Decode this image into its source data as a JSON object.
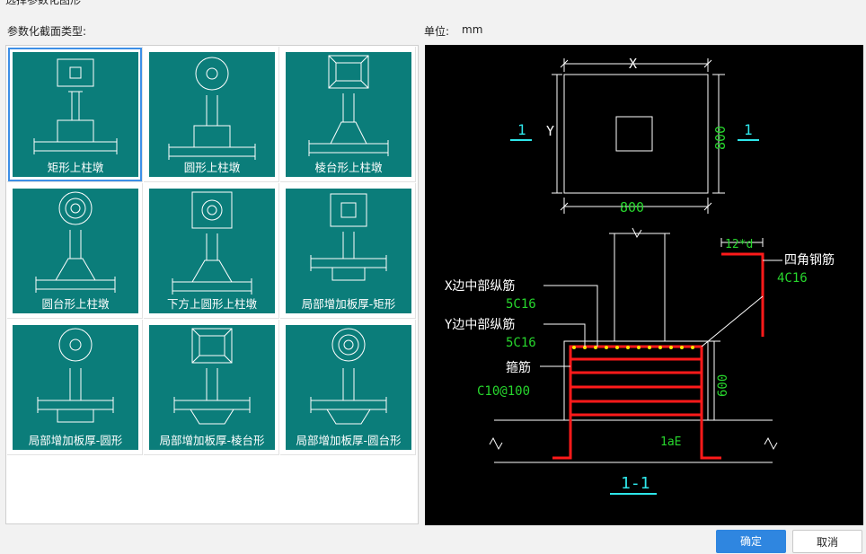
{
  "window": {
    "title": "选择参数化图形"
  },
  "left_label": "参数化截面类型:",
  "unit": {
    "label": "单位:",
    "value": "mm"
  },
  "tiles": [
    {
      "label": "矩形上柱墩",
      "icon": "rect-pier-icon"
    },
    {
      "label": "圆形上柱墩",
      "icon": "round-pier-icon"
    },
    {
      "label": "棱台形上柱墩",
      "icon": "frustum-pier-icon"
    },
    {
      "label": "圆台形上柱墩",
      "icon": "cone-frustum-pier-icon"
    },
    {
      "label": "下方上圆形上柱墩",
      "icon": "square-round-pier-icon"
    },
    {
      "label": "局部增加板厚-矩形",
      "icon": "slab-thicken-rect-icon"
    },
    {
      "label": "局部增加板厚-圆形",
      "icon": "slab-thicken-round-icon"
    },
    {
      "label": "局部增加板厚-棱台形",
      "icon": "slab-thicken-frustum-icon"
    },
    {
      "label": "局部增加板厚-圆台形",
      "icon": "slab-thicken-cone-icon"
    }
  ],
  "selected_index": 0,
  "preview": {
    "dim_x": "X",
    "dim_y": "Y",
    "dim_800_h": "800",
    "dim_800_v": "800",
    "section_mark": "1",
    "section_title": "1-1",
    "x_mid_bars_label": "X边中部纵筋",
    "x_mid_bars_value": "5C16",
    "y_mid_bars_label": "Y边中部纵筋",
    "y_mid_bars_value": "5C16",
    "stirrup_label": "箍筋",
    "stirrup_value": "C10@100",
    "corner_bars_label": "四角钢筋",
    "corner_bars_value": "4C16",
    "anchor_len": "12*d",
    "height": "600",
    "lae": "1aE"
  },
  "buttons": {
    "ok": "确定",
    "cancel": "取消"
  }
}
